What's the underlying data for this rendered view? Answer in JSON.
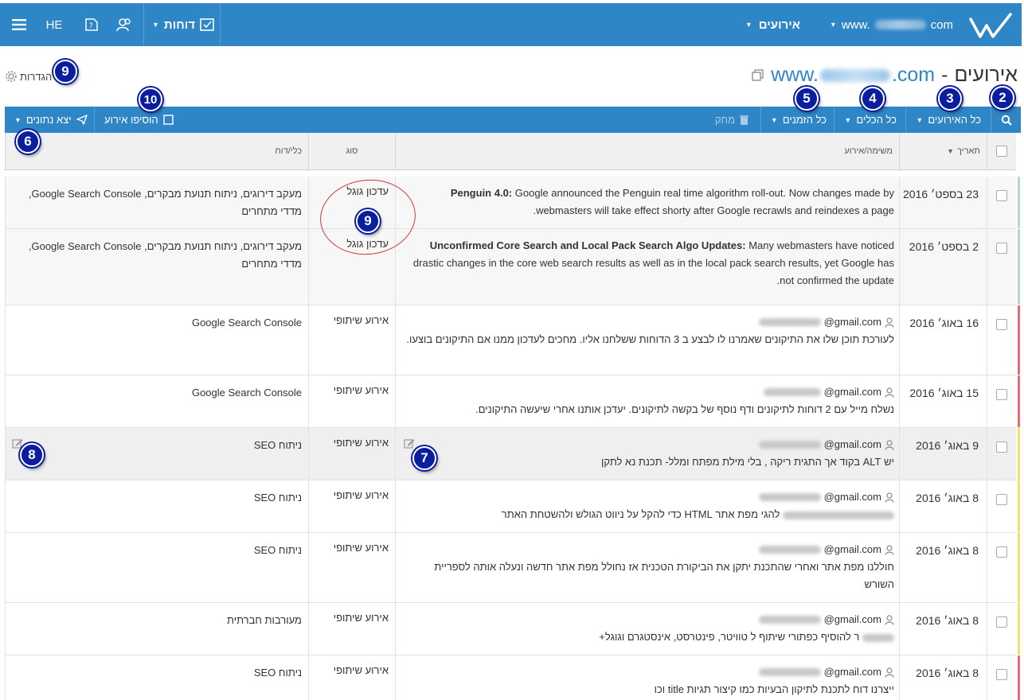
{
  "header": {
    "domain_prefix": "www.",
    "domain_suffix": "com",
    "events_menu": "אירועים",
    "reports_menu": "דוחות",
    "lang": "HE"
  },
  "page": {
    "title": "אירועים",
    "separator": "-",
    "domain_prefix": "www.",
    "domain_suffix": ".com",
    "settings_label": "הגדרות"
  },
  "toolbar": {
    "all_events": "כל האירועים",
    "all_tools": "כל הכלים",
    "all_times": "כל הזמנים",
    "delete": "מחק",
    "add_event": "הוסיפו אירוע",
    "export": "יצא נתונים"
  },
  "table": {
    "headers": {
      "date": "תאריך",
      "task": "משימה/אירוע",
      "type": "סוג",
      "tool": "כלי/דוח"
    },
    "rows": [
      {
        "date": "23 בספט׳ 2016",
        "stripe": "#b9d3d9",
        "task_bold": "Penguin 4.0:",
        "task_text": "Google announced the Penguin real time algorithm roll-out. Now changes made by webmasters will take effect shorty after Google recrawls and reindexes a page.",
        "type": "עדכון גוגל",
        "tool": "מעקב דירוגים, ניתוח תנועת מבקרים, Google Search Console, מדדי מתחרים"
      },
      {
        "date": "2 בספט׳ 2016",
        "stripe": "#b9d3d9",
        "task_bold": "Unconfirmed Core Search and Local Pack Search Algo Updates:",
        "task_text": "Many webmasters have noticed drastic changes in the core web search results as well as in the local pack search results, yet Google has not confirmed the update.",
        "type": "עדכון גוגל",
        "tool": "מעקב דירוגים, ניתוח תנועת מבקרים, Google Search Console, מדדי מתחרים"
      },
      {
        "date": "16 באוג׳ 2016",
        "stripe": "#e96a7a",
        "user": "@gmail.com",
        "task_text": "לעורכת תוכן שלו את התיקונים שאמרנו לו לבצע ב 3 הדוחות ששלחנו אליו. מחכים לעדכון ממנו אם התיקונים בוצעו.",
        "type": "אירוע שיתופי",
        "tool": "Google Search Console"
      },
      {
        "date": "15 באוג׳ 2016",
        "stripe": "#e96a7a",
        "user": "@gmail.com",
        "task_text": "נשלח מייל עם 2 דוחות לתיקונים ודף נוסף של בקשה לתיקונים. יעדכן אותנו אחרי שיעשה התיקונים.",
        "type": "אירוע שיתופי",
        "tool": "Google Search Console"
      },
      {
        "date": "9 באוג׳ 2016",
        "stripe": "#f4e06a",
        "user": "@gmail.com",
        "task_text": "יש ALT בקוד אך התגית ריקה , בלי מילת מפתח ומלל- תכנת נא לתקן",
        "type": "אירוע שיתופי",
        "tool": "ניתוח SEO"
      },
      {
        "date": "8 באוג׳ 2016",
        "stripe": "#f4e06a",
        "user": "@gmail.com",
        "task_text": "להגי מפת אתר HTML כדי להקל על ניווט הגולש ולהשטחת האתר",
        "type": "אירוע שיתופי",
        "tool": "ניתוח SEO"
      },
      {
        "date": "8 באוג׳ 2016",
        "stripe": "#f4e06a",
        "user": "@gmail.com",
        "task_text": "חוללנו מפת אתר ואחרי שהתכנת יתקן את הביקורת הטכנית אז נחולל מפת אתר חדשה ונעלה אותה לספריית השורש",
        "type": "אירוע שיתופי",
        "tool": "ניתוח SEO"
      },
      {
        "date": "8 באוג׳ 2016",
        "stripe": "#f4e06a",
        "user": "@gmail.com",
        "task_text": "ר להוסיף כפתורי שיתוף ל טוויטר, פינטרסט, אינסטגרם וגוגל+",
        "type": "אירוע שיתופי",
        "tool": "מעורבות חברתית"
      },
      {
        "date": "8 באוג׳ 2016",
        "stripe": "#e96a7a",
        "user": "@gmail.com",
        "task_text": "ייצרנו דוח לתכנת לתיקון הבעיות כמו קיצור תגיות title וכו",
        "type": "אירוע שיתופי",
        "tool": "ניתוח SEO"
      }
    ]
  },
  "badges": {
    "b2": "2",
    "b3": "3",
    "b4": "4",
    "b5": "5",
    "b6": "6",
    "b7": "7",
    "b8": "8",
    "b9": "9",
    "b10": "10"
  }
}
